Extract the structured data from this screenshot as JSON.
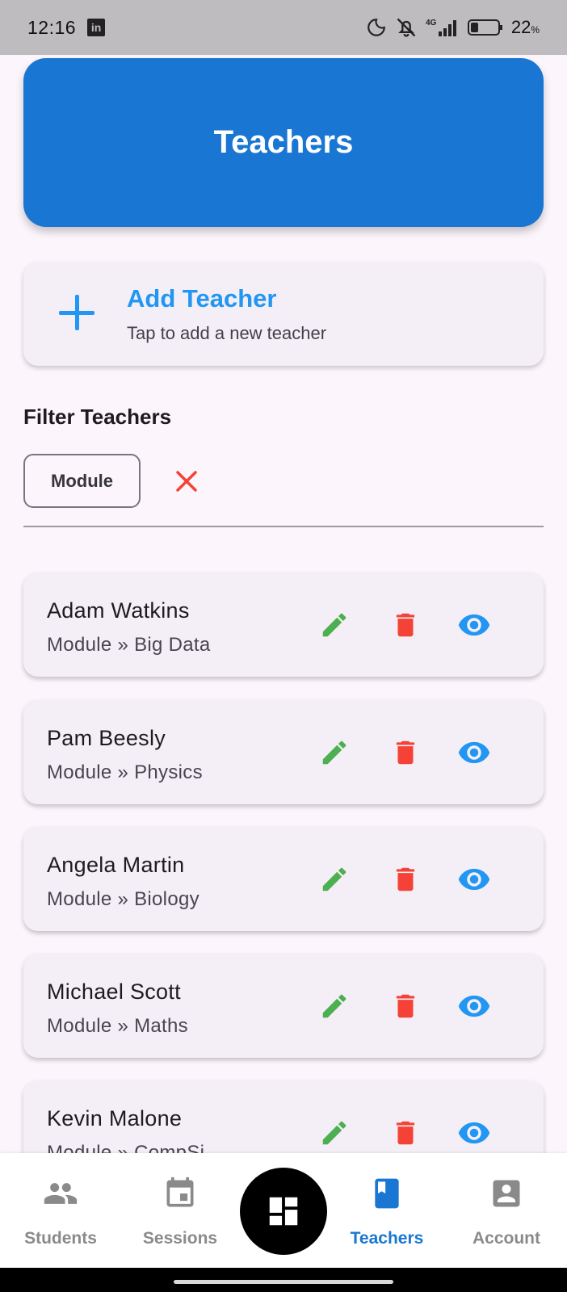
{
  "status_bar": {
    "time": "12:16",
    "network": "4G",
    "battery": "22",
    "battery_unit": "%"
  },
  "header": {
    "title": "Teachers"
  },
  "add_teacher": {
    "title": "Add Teacher",
    "subtitle": "Tap to add a new teacher"
  },
  "filter": {
    "heading": "Filter Teachers",
    "chip_label": "Module"
  },
  "teachers": [
    {
      "name": "Adam Watkins",
      "module": "Module » Big Data"
    },
    {
      "name": "Pam Beesly",
      "module": "Module » Physics"
    },
    {
      "name": "Angela Martin",
      "module": "Module » Biology"
    },
    {
      "name": "Michael Scott",
      "module": "Module » Maths"
    },
    {
      "name": "Kevin Malone",
      "module": "Module » CompSi"
    }
  ],
  "nav": {
    "students": "Students",
    "sessions": "Sessions",
    "teachers": "Teachers",
    "account": "Account",
    "active": "teachers"
  },
  "colors": {
    "primary": "#1976d2",
    "accent": "#2196f3",
    "edit": "#4caf50",
    "delete": "#f44336",
    "view": "#2196f3"
  }
}
